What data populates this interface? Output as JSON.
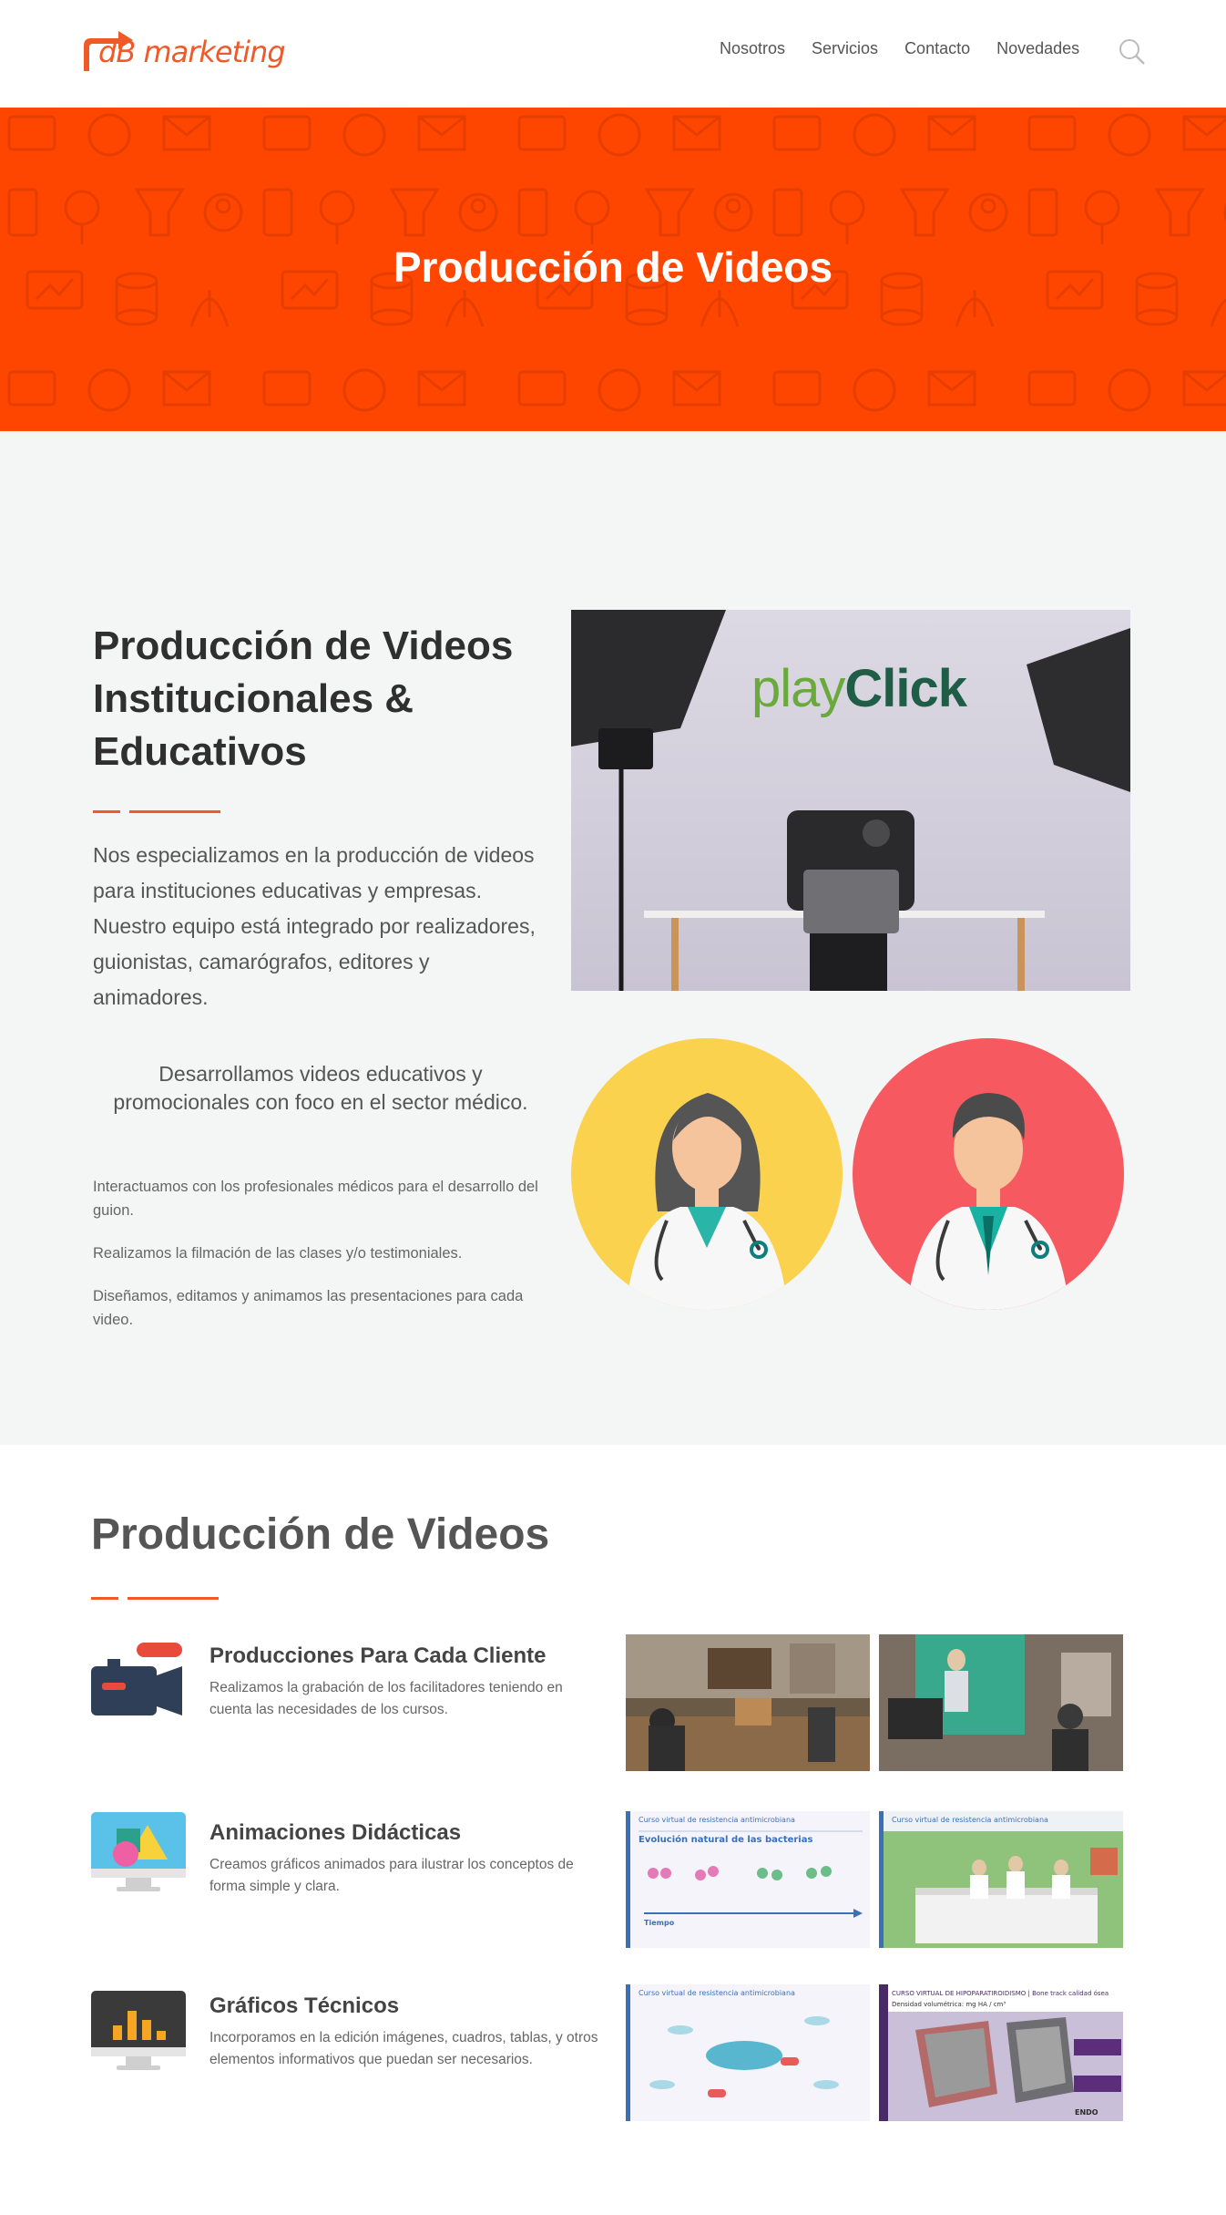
{
  "header": {
    "logo_text": "dB marketing",
    "nav": [
      "Nosotros",
      "Servicios",
      "Contacto",
      "Novedades"
    ]
  },
  "hero": {
    "title": "Producción de Videos"
  },
  "intro": {
    "title": "Producción de Videos Institucionales & Educativos",
    "lead": "Nos especializamos en la producción de videos para instituciones educativas y empresas. Nuestro equipo está integrado por realizadores, guionistas, camarógrafos, editores y animadores.",
    "subtitle": "Desarrollamos videos educativos y promocionales con foco en el sector médico.",
    "points": [
      "Interactuamos con los profesionales médicos para el desarrollo del guion.",
      "Realizamos la filmación de las clases y/o testimoniales.",
      "Diseñamos, editamos y animamos las presentaciones para cada video."
    ],
    "photo_brand": {
      "play": "play",
      "click": "Click"
    }
  },
  "production": {
    "title": "Producción de Videos",
    "features": [
      {
        "title": "Producciones Para Cada Cliente",
        "desc": "Realizamos la grabación de los facilitadores teniendo en cuenta las necesidades de los cursos.",
        "icon": "video-camera-icon"
      },
      {
        "title": "Animaciones Didácticas",
        "desc": "Creamos gráficos animados para ilustrar los conceptos de forma simple y clara.",
        "icon": "monitor-shapes-icon"
      },
      {
        "title": "Gráficos Técnicos",
        "desc": "Incorporamos en la edición imágenes, cuadros, tablas, y otros elementos informativos que puedan ser necesarios.",
        "icon": "monitor-chart-icon"
      }
    ],
    "thumb_labels": {
      "course": "Curso virtual de resistencia antimicrobiana",
      "evolution": "Evolución natural de las bacterias",
      "time": "Tiempo",
      "hipo": "CURSO VIRTUAL DE HIPOPARATIROIDISMO | Bone track calidad ósea",
      "density": "Densidad volumétrica: mg HA / cm³",
      "endo": "ENDO"
    }
  },
  "colors": {
    "accent": "#f05a28",
    "hero_bg": "#ff4600",
    "section_bg": "#f4f5f5"
  }
}
